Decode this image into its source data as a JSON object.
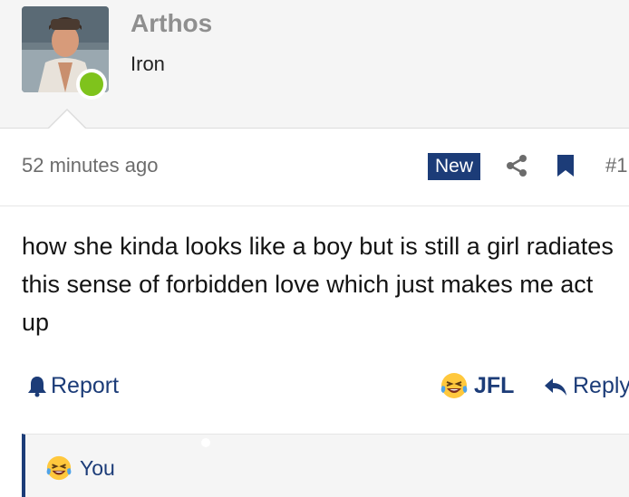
{
  "user": {
    "name": "Arthos",
    "title": "Iron",
    "status_color": "#7fc31c"
  },
  "post": {
    "time": "52 minutes ago",
    "badge": "New",
    "number": "#1",
    "text": "how she kinda looks like a boy but is still a girl radiates this sense of forbidden love which just makes me act up"
  },
  "actions": {
    "report_label": "Report",
    "reaction_label": "JFL",
    "reply_label": "Reply"
  },
  "reactions": {
    "by": "You"
  },
  "icons": {
    "share": "share-icon",
    "bookmark": "bookmark-icon",
    "report": "bell-icon",
    "reply": "reply-arrow-icon",
    "reaction": "laughing-crying-emoji"
  },
  "colors": {
    "accent": "#1c3c78",
    "muted_text": "#6c6c6c",
    "username": "#8f8f8f",
    "header_bg": "#f5f5f5"
  }
}
